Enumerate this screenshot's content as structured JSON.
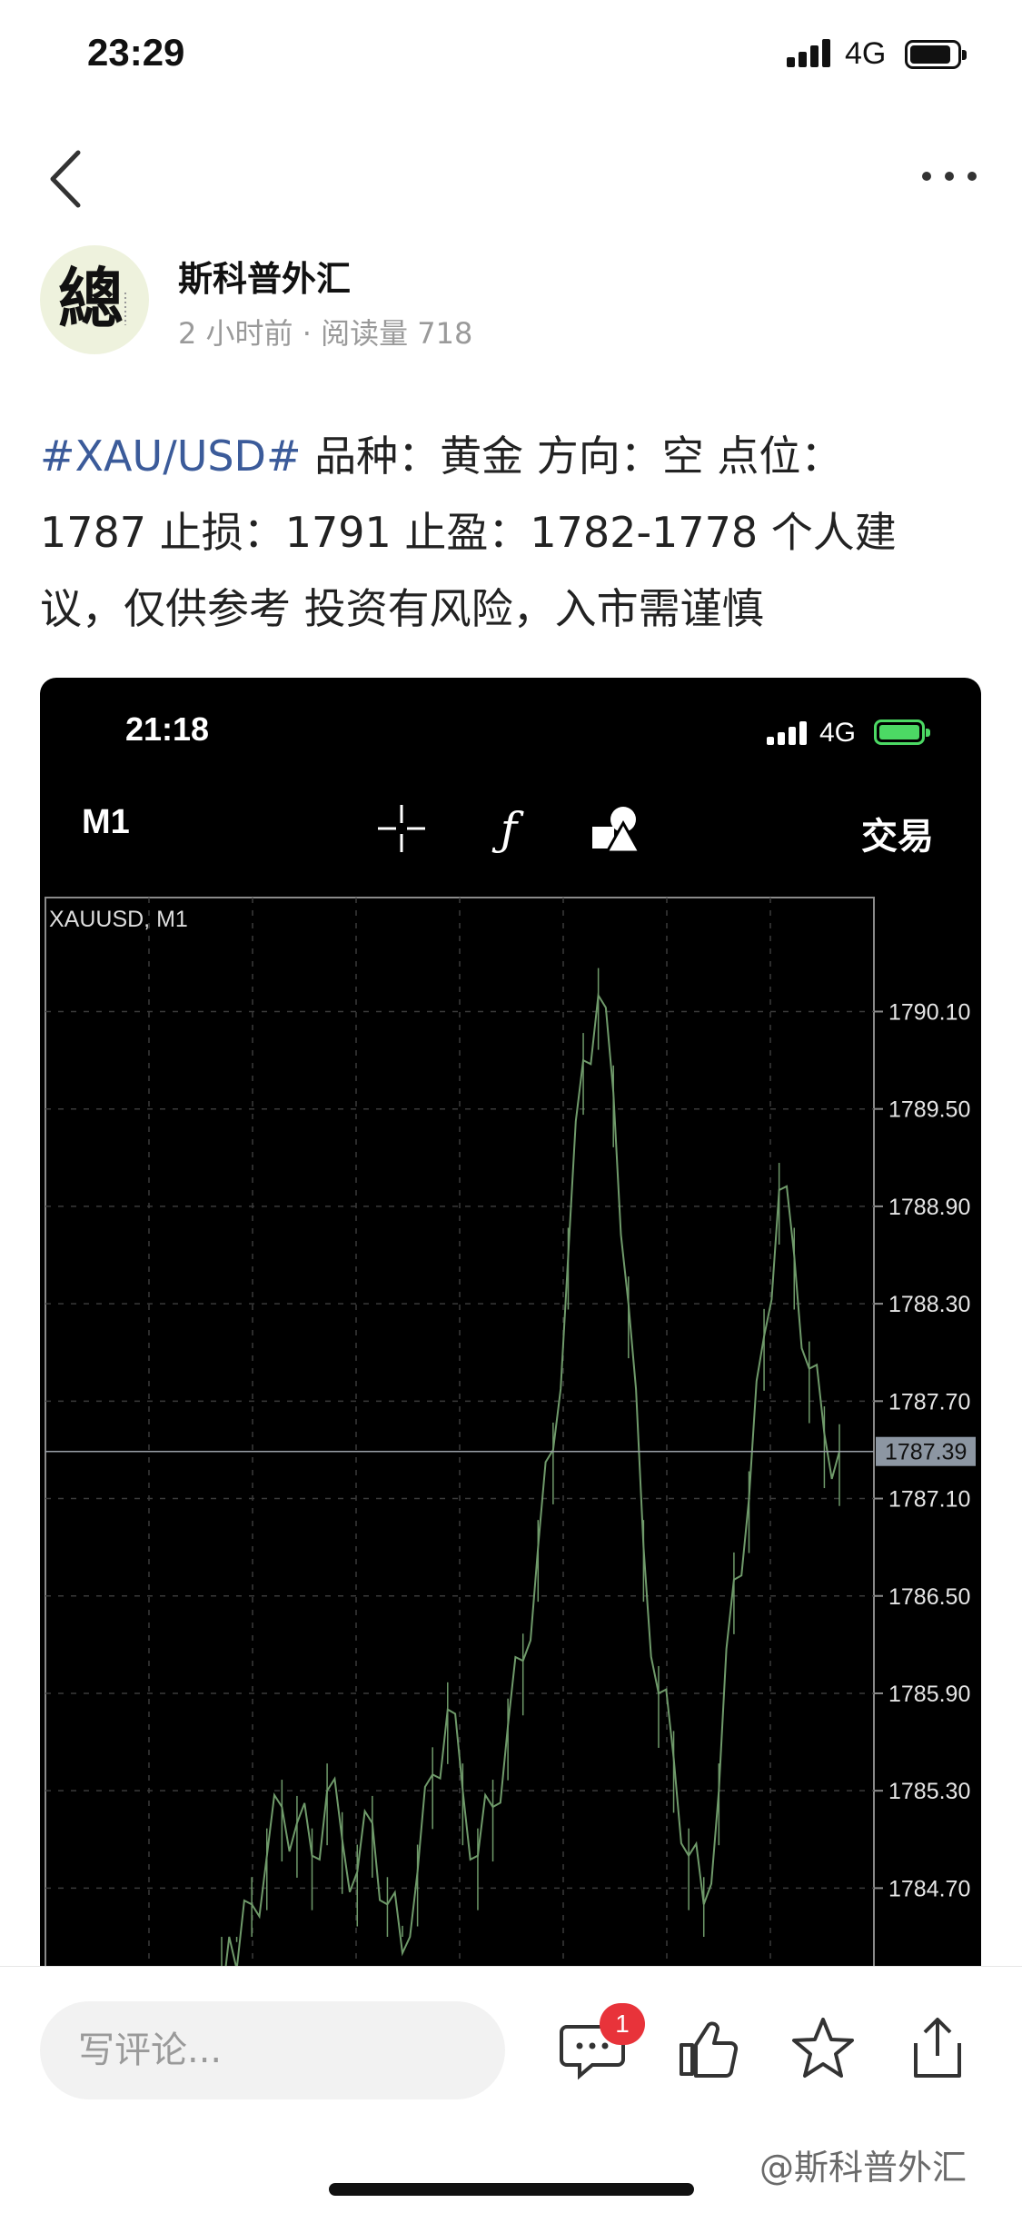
{
  "status_bar": {
    "time": "23:29",
    "network": "4G"
  },
  "nav": {
    "back_icon": "chevron-left-icon",
    "more_icon": "ellipsis-icon"
  },
  "author": {
    "name": "斯科普外汇",
    "time_ago": "2 小时前",
    "reads": "· 阅读量 718",
    "avatar_glyph": "總"
  },
  "post": {
    "hashtag": "#XAU/USD#",
    "line1_rest": " 品种：黄金 方向：空 点位：",
    "line2": "1787 止损：1791 止盈：1782-1778 个人建",
    "line3": "议，仅供参考 投资有风险，入市需谨慎"
  },
  "screenshot": {
    "time": "21:18",
    "network": "4G",
    "timeframe": "M1",
    "trade_label": "交易",
    "tools": [
      "crosshair-icon",
      "function-icon",
      "shapes-icon"
    ],
    "battery_color": "#4cd964"
  },
  "chart_data": {
    "type": "line",
    "title": "XAUUSD, M1",
    "y_ticks": [
      1790.1,
      1789.5,
      1788.9,
      1788.3,
      1787.7,
      1787.1,
      1786.5,
      1785.9,
      1785.3,
      1784.7
    ],
    "current_price": "1787.39",
    "ylim": [
      1784.4,
      1790.5
    ],
    "series": [
      {
        "values": [
          1784.0,
          1784.2,
          1784.6,
          1784.9,
          1785.2,
          1785.1,
          1784.9,
          1785.3,
          1785.0,
          1784.8,
          1785.1,
          1784.6,
          1784.3,
          1784.8,
          1785.4,
          1785.8,
          1785.3,
          1784.9,
          1785.2,
          1785.7,
          1786.1,
          1786.8,
          1787.4,
          1788.6,
          1789.8,
          1790.2,
          1789.6,
          1788.3,
          1786.8,
          1785.9,
          1785.5,
          1784.9,
          1784.6,
          1785.3,
          1786.6,
          1787.1,
          1788.1,
          1789.0,
          1788.6,
          1787.9,
          1787.5,
          1787.39
        ]
      }
    ],
    "grid": true,
    "line_color": "#6f9a6a"
  },
  "bottom": {
    "comment_placeholder": "写评论...",
    "comment_count": "1",
    "watermark": "@斯科普外汇"
  }
}
